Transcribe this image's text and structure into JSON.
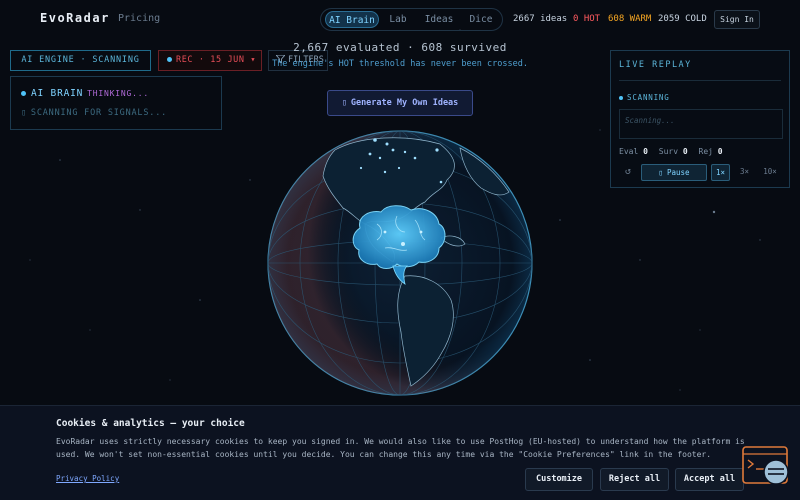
{
  "header": {
    "brand": "EvoRadar",
    "pricing": "Pricing",
    "modes": [
      "AI Brain",
      "Lab",
      "Ideas",
      "Dice"
    ],
    "active_mode": "AI Brain",
    "stats": [
      {
        "label": "2667 ideas",
        "color": "#c7d3e0"
      },
      {
        "label": "0 HOT",
        "color": "#ff5a5f"
      },
      {
        "label": "608 WARM",
        "color": "#f5a623"
      },
      {
        "label": "2059 COLD",
        "color": "#c7d3e0"
      }
    ],
    "sign_in": "Sign In"
  },
  "left": {
    "engine_status": "AI ENGINE · SCANNING",
    "rec_label": "REC · 15 JUN ▾",
    "filters_label": "FILTERS",
    "brain_label": "AI BRAIN",
    "brain_state": "THINKING...",
    "scan_label": "SCANNING FOR SIGNALS..."
  },
  "center": {
    "summary": "2,667 evaluated  ·  608 survived",
    "subline": "The engine's HOT threshold has never been crossed.",
    "generate_button": "Generate My Own Ideas"
  },
  "replay": {
    "title": "LIVE REPLAY",
    "status": "SCANNING",
    "placeholder": "Scanning...",
    "eval_label": "Eval",
    "eval_value": "0",
    "surv_label": "Surv",
    "surv_value": "0",
    "rej_label": "Rej",
    "rej_value": "0",
    "reset": "↺",
    "pause": "Pause",
    "speeds": [
      "1×",
      "3×",
      "10×"
    ],
    "active_speed": "1×"
  },
  "cookie": {
    "title": "Cookies & analytics — your choice",
    "body": "EvoRadar uses strictly necessary cookies to keep you signed in. We would also like to use PostHog (EU-hosted) to understand how the platform is used. We won't set non-essential cookies until you decide. You can change this any time via the \"Cookie Preferences\" link in the footer.",
    "privacy_link": "Privacy Policy",
    "customize": "Customize",
    "reject": "Reject all",
    "accept": "Accept all"
  },
  "colors": {
    "accent": "#4fc3f7",
    "background": "#070b12",
    "hot": "#ff5a5f",
    "warm": "#f5a623"
  },
  "icons": {
    "filters": "filter-icon",
    "generate": "sparkle-icon",
    "pause": "pause-icon",
    "reset": "reset-icon",
    "widget": "terminal-chat-icon"
  }
}
